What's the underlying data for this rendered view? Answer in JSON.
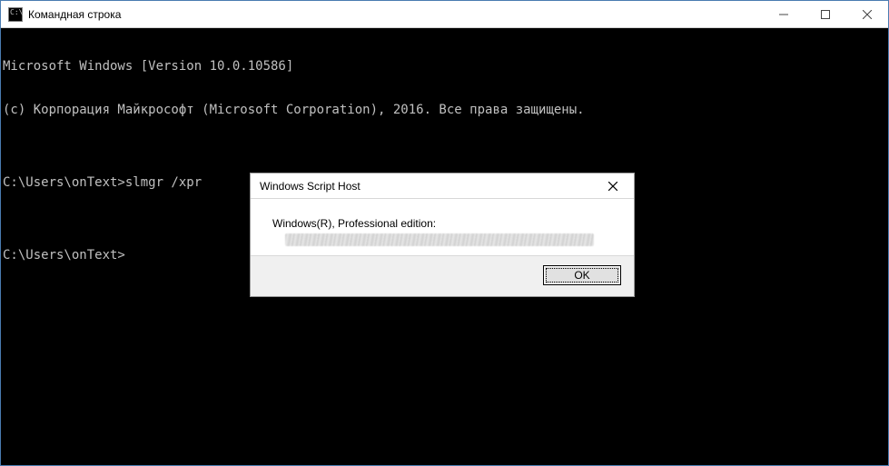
{
  "window": {
    "title": "Командная строка",
    "controls": {
      "minimize": "–",
      "maximize": "▢",
      "close": "✕"
    }
  },
  "console": {
    "lines": [
      "Microsoft Windows [Version 10.0.10586]",
      "(c) Корпорация Майкрософт (Microsoft Corporation), 2016. Все права защищены.",
      "",
      "C:\\Users\\onText>slmgr /xpr",
      "",
      "C:\\Users\\onText>"
    ]
  },
  "dialog": {
    "title": "Windows Script Host",
    "message": "Windows(R), Professional edition:",
    "ok_label": "OK"
  }
}
